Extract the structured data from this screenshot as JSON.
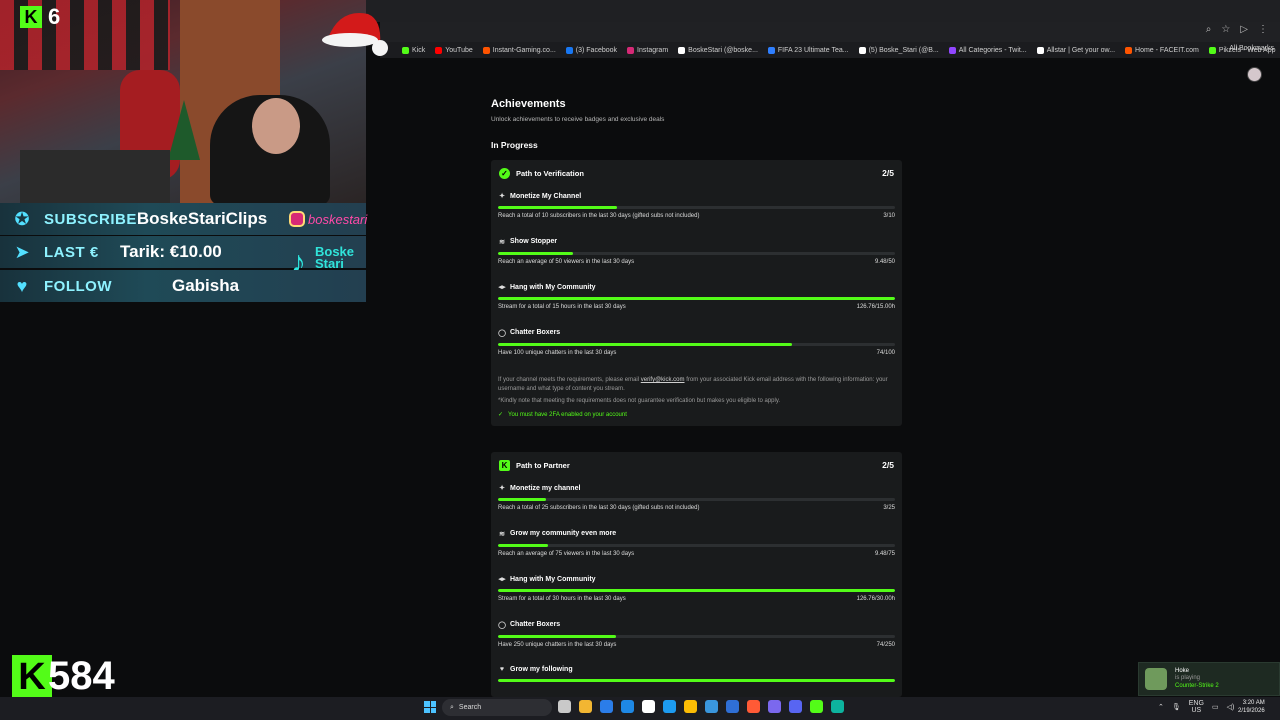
{
  "browser": {
    "bookmarks": [
      {
        "label": "Kick",
        "color": "#53fc18"
      },
      {
        "label": "YouTube",
        "color": "#ff0000"
      },
      {
        "label": "Instant-Gaming.co...",
        "color": "#ff5400"
      },
      {
        "label": "(3) Facebook",
        "color": "#1877f2"
      },
      {
        "label": "Instagram",
        "color": "#d62976"
      },
      {
        "label": "BoskeStari (@boske...",
        "color": "#ffffff"
      },
      {
        "label": "FIFA 23 Ultimate Tea...",
        "color": "#2f7fff"
      },
      {
        "label": "(5) Boske_Stari (@B...",
        "color": "#ffffff"
      },
      {
        "label": "All Categories - Twit...",
        "color": "#9146ff"
      },
      {
        "label": "Allstar | Get your ow...",
        "color": "#ffffff"
      },
      {
        "label": "Home - FACEIT.com",
        "color": "#ff5500"
      },
      {
        "label": "Pikzels - Web App",
        "color": "#53fc18"
      }
    ],
    "all_bookmarks": "All Bookmarks"
  },
  "overlay": {
    "viewer_count": "6",
    "subscribe_label": "SUBSCRIBE",
    "subscribe_value": "BoskeStariClips",
    "instagram_handle": "boskestari",
    "last_label": "LAST €",
    "last_value": "Tarik: €10.00",
    "follow_label": "FOLLOW",
    "follow_value": "Gabisha",
    "tiktok_name_1": "Boske",
    "tiktok_name_2": "Stari",
    "follower_count": "584",
    "handle": "boskestari"
  },
  "page": {
    "title": "Achievements",
    "subtitle": "Unlock achievements to receive badges and exclusive deals",
    "section": "In Progress",
    "verification": {
      "title": "Path to Verification",
      "progress": "2/5",
      "requirements": [
        {
          "icon": "✦",
          "title": "Monetize My Channel",
          "desc": "Reach a total of 10 subscribers in the last 30 days (gifted subs not included)",
          "value": "3/10",
          "fill": 0.3
        },
        {
          "icon": "≋",
          "title": "Show Stopper",
          "desc": "Reach an average of 50 viewers in the last 30 days",
          "value": "9.48/50",
          "fill": 0.19
        },
        {
          "icon": "◂▸",
          "title": "Hang with My Community",
          "desc": "Stream for a total of 15 hours in the last 30 days",
          "value": "126.76/15.00h",
          "fill": 1.0
        },
        {
          "icon": "◯",
          "title": "Chatter Boxers",
          "desc": "Have 100 unique chatters in the last 30 days",
          "value": "74/100",
          "fill": 0.74
        }
      ],
      "note_1": "If your channel meets the requirements, please email",
      "note_link": "verify@kick.com",
      "note_2": "from your associated Kick email address with the following information: your username and what type of content you stream.",
      "note_3": "*Kindly note that meeting the requirements does not guarantee verification but makes you eligible to apply.",
      "twofa": "You must have 2FA enabled on your account"
    },
    "partner": {
      "title": "Path to Partner",
      "progress": "2/5",
      "requirements": [
        {
          "icon": "✦",
          "title": "Monetize my channel",
          "desc": "Reach a total of 25 subscribers in the last 30 days (gifted subs not included)",
          "value": "3/25",
          "fill": 0.12
        },
        {
          "icon": "≋",
          "title": "Grow my community even more",
          "desc": "Reach an average of 75 viewers in the last 30 days",
          "value": "9.48/75",
          "fill": 0.126
        },
        {
          "icon": "◂▸",
          "title": "Hang with My Community",
          "desc": "Stream for a total of 30 hours in the last 30 days",
          "value": "126.76/30.00h",
          "fill": 1.0
        },
        {
          "icon": "◯",
          "title": "Chatter Boxers",
          "desc": "Have 250 unique chatters in the last 30 days",
          "value": "74/250",
          "fill": 0.296
        },
        {
          "icon": "♥",
          "title": "Grow my following",
          "desc": "",
          "value": "",
          "fill": 1.0
        }
      ]
    }
  },
  "notification": {
    "name": "Hoke",
    "status": "is playing",
    "game": "Counter-Strike 2"
  },
  "taskbar": {
    "search_placeholder": "Search",
    "lang_1": "ENG",
    "lang_2": "US",
    "time": "3:20 AM",
    "date": "2/19/2026",
    "app_colors": [
      "#c9c9c9",
      "#f2b632",
      "#2b7de9",
      "#1e88e5",
      "#ffffff",
      "#1d9bf0",
      "#fbbc05",
      "#3a96dd",
      "#2f6fd6",
      "#ff5a36",
      "#7b68ee",
      "#5865f2",
      "#53fc18",
      "#0db39e"
    ]
  }
}
